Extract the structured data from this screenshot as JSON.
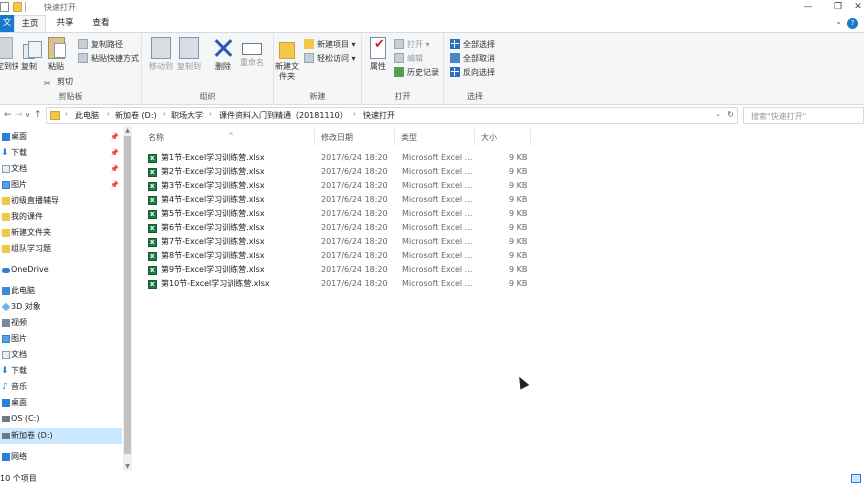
{
  "window": {
    "title": "快速打开",
    "controls": [
      "—",
      "❐",
      "✕"
    ]
  },
  "ribbon": {
    "tabs": {
      "file": "文件",
      "home": "主页",
      "share": "共享",
      "view": "查看"
    },
    "groups": {
      "clipboard": {
        "label": "剪贴板",
        "pin": "固定到快速访问",
        "copy": "复制",
        "paste": "粘贴",
        "copy_path": "复制路径",
        "paste_shortcut": "粘贴快捷方式",
        "cut": "剪切"
      },
      "organize": {
        "label": "组织",
        "move_to": "移动到",
        "copy_to": "复制到",
        "delete": "删除",
        "rename": "重命名"
      },
      "new": {
        "label": "新建",
        "new_folder": "新建文件夹",
        "new_item": "新建项目 ▾",
        "easy_access": "轻松访问 ▾"
      },
      "open": {
        "label": "打开",
        "properties": "属性",
        "open": "打开 ▾",
        "edit": "编辑",
        "history": "历史记录"
      },
      "select": {
        "label": "选择",
        "select_all": "全部选择",
        "select_none": "全部取消",
        "invert": "反向选择"
      }
    }
  },
  "address": {
    "back": "←",
    "forward": "→",
    "recent": "∨",
    "up": "↑",
    "crumbs": [
      "此电脑",
      "新加卷 (D:)",
      "职场大学",
      "课件资料入门到精通（20181110）",
      "快速打开"
    ],
    "search_placeholder": "搜索\"快速打开\""
  },
  "nav": {
    "items": [
      {
        "label": "桌面",
        "icon": "desktop-icon",
        "pinned": true
      },
      {
        "label": "下载",
        "icon": "download-icon",
        "pinned": true
      },
      {
        "label": "文档",
        "icon": "document-icon",
        "pinned": true
      },
      {
        "label": "图片",
        "icon": "picture-icon",
        "pinned": true
      },
      {
        "label": "初级直播辅导",
        "icon": "folder-icon"
      },
      {
        "label": "我的课件",
        "icon": "folder-icon"
      },
      {
        "label": "新建文件夹",
        "icon": "folder-icon"
      },
      {
        "label": "组队学习题",
        "icon": "folder-icon"
      },
      {
        "label": "OneDrive",
        "icon": "onedrive-icon"
      },
      {
        "label": "此电脑",
        "icon": "this-pc-icon"
      },
      {
        "label": "3D 对象",
        "icon": "3d-objects-icon"
      },
      {
        "label": "视频",
        "icon": "video-icon"
      },
      {
        "label": "图片",
        "icon": "picture-icon"
      },
      {
        "label": "文档",
        "icon": "document-icon"
      },
      {
        "label": "下载",
        "icon": "download-icon"
      },
      {
        "label": "音乐",
        "icon": "music-icon"
      },
      {
        "label": "桌面",
        "icon": "desktop-icon"
      },
      {
        "label": "OS (C:)",
        "icon": "drive-icon"
      },
      {
        "label": "新加卷 (D:)",
        "icon": "drive-icon",
        "selected": true
      },
      {
        "label": "网络",
        "icon": "network-icon"
      }
    ]
  },
  "list": {
    "columns": {
      "name": "名称",
      "date": "修改日期",
      "type": "类型",
      "size": "大小"
    },
    "rows": [
      {
        "name": "第1节-Excel学习训练营.xlsx",
        "date": "2017/6/24 18:20",
        "type": "Microsoft Excel ...",
        "size": "9 KB"
      },
      {
        "name": "第2节-Excel学习训练营.xlsx",
        "date": "2017/6/24 18:20",
        "type": "Microsoft Excel ...",
        "size": "9 KB"
      },
      {
        "name": "第3节-Excel学习训练营.xlsx",
        "date": "2017/6/24 18:20",
        "type": "Microsoft Excel ...",
        "size": "9 KB"
      },
      {
        "name": "第4节-Excel学习训练营.xlsx",
        "date": "2017/6/24 18:20",
        "type": "Microsoft Excel ...",
        "size": "9 KB"
      },
      {
        "name": "第5节-Excel学习训练营.xlsx",
        "date": "2017/6/24 18:20",
        "type": "Microsoft Excel ...",
        "size": "9 KB"
      },
      {
        "name": "第6节-Excel学习训练营.xlsx",
        "date": "2017/6/24 18:20",
        "type": "Microsoft Excel ...",
        "size": "9 KB"
      },
      {
        "name": "第7节-Excel学习训练营.xlsx",
        "date": "2017/6/24 18:20",
        "type": "Microsoft Excel ...",
        "size": "9 KB"
      },
      {
        "name": "第8节-Excel学习训练营.xlsx",
        "date": "2017/6/24 18:20",
        "type": "Microsoft Excel ...",
        "size": "9 KB"
      },
      {
        "name": "第9节-Excel学习训练营.xlsx",
        "date": "2017/6/24 18:20",
        "type": "Microsoft Excel ...",
        "size": "9 KB"
      },
      {
        "name": "第10节-Excel学习训练营.xlsx",
        "date": "2017/6/24 18:20",
        "type": "Microsoft Excel ...",
        "size": "9 KB"
      }
    ]
  },
  "status": {
    "count": "10 个项目"
  }
}
